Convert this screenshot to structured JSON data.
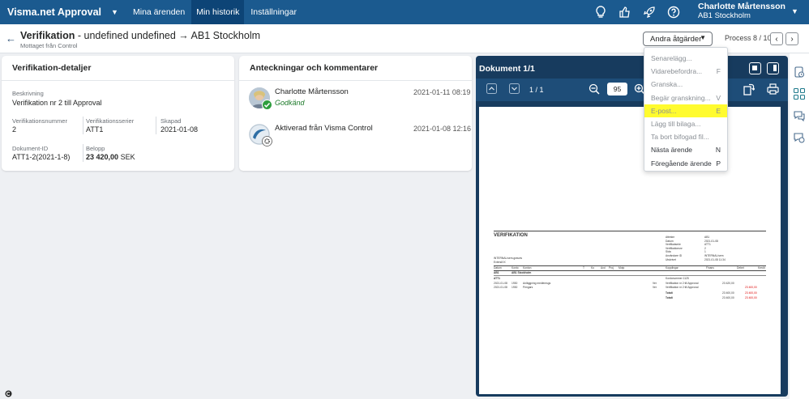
{
  "app": {
    "title": "Visma.net Approval",
    "nav": [
      {
        "label": "Mina ärenden",
        "active": false
      },
      {
        "label": "Min historik",
        "active": true
      },
      {
        "label": "Inställningar",
        "active": false
      }
    ],
    "user": {
      "name": "Charlotte Mårtensson",
      "org": "AB1 Stockholm"
    },
    "icons": [
      "lightbulb-icon",
      "thumbs-icon",
      "rocket-icon",
      "help-icon"
    ]
  },
  "header": {
    "title_bold": "Verifikation",
    "title_rest": " - undefined undefined → AB1 Stockholm",
    "subtitle": "Mottaget från Control",
    "actions_label": "Andra åtgärder",
    "process": "Process 8 / 10"
  },
  "details": {
    "heading": "Verifikation-detaljer",
    "description_label": "Beskrivning",
    "description_value": "Verifikation nr 2 till Approval",
    "number_label": "Verifikationsnummer",
    "number_value": "2",
    "series_label": "Verifikationsserier",
    "series_value": "ATT1",
    "created_label": "Skapad",
    "created_value": "2021-01-08",
    "docid_label": "Dokument-ID",
    "docid_value": "ATT1-2(2021-1-8)",
    "amount_label": "Belopp",
    "amount_value": "23 420,00",
    "amount_currency": "SEK"
  },
  "comments": {
    "heading": "Anteckningar och kommentarer",
    "items": [
      {
        "name": "Charlotte Mårtensson",
        "status": "Godkänd",
        "time": "2021-01-11 08:19"
      },
      {
        "name": "Aktiverad från Visma Control",
        "status": "",
        "time": "2021-01-08 12:16"
      }
    ]
  },
  "viewer": {
    "title": "Dokument 1/1",
    "page": "1 / 1",
    "zoom": "95"
  },
  "menu": {
    "items": [
      {
        "label": "Senarelägg...",
        "key": "",
        "enabled": false,
        "highlighted": false
      },
      {
        "label": "Vidarebefordra...",
        "key": "F",
        "enabled": false,
        "highlighted": false
      },
      {
        "label": "Granska...",
        "key": "",
        "enabled": false,
        "highlighted": false
      },
      {
        "label": "Begär granskning...",
        "key": "V",
        "enabled": false,
        "highlighted": false
      },
      {
        "label": "E-post...",
        "key": "E",
        "enabled": false,
        "highlighted": true
      },
      {
        "label": "Lägg till bilaga...",
        "key": "",
        "enabled": false,
        "highlighted": false
      },
      {
        "label": "Ta bort bifogad fil...",
        "key": "",
        "enabled": false,
        "highlighted": false
      },
      {
        "label": "Nästa ärende",
        "key": "N",
        "enabled": true,
        "highlighted": false
      },
      {
        "label": "Föregående ärende",
        "key": "P",
        "enabled": true,
        "highlighted": false
      }
    ]
  },
  "doc": {
    "heading": "VERIFIKATION",
    "meta": [
      [
        "Attestnr",
        "AB1"
      ],
      [
        "Datum",
        "2021-01-08"
      ],
      [
        "Verifikatserie",
        "ATT1"
      ],
      [
        "Verifikationsnr",
        "2"
      ],
      [
        "Sida",
        "1"
      ],
      [
        "Användare ID",
        "INTERNAL/sem"
      ],
      [
        "Utskrivet",
        "2021-01-08 11:34"
      ]
    ],
    "left_meta": [
      "INTERNAL/sem-grasvis",
      "ExtendXX"
    ],
    "columns": [
      "Datum",
      "Konto",
      "Konton",
      "T",
      "Ko",
      "Avd",
      "Proj",
      "Motp",
      "Kopplingar",
      "Finans",
      "Debet",
      "Kredit"
    ],
    "org_row": [
      "AB1",
      "AB1 Stockholm"
    ],
    "series_row": [
      "ATT1",
      "Kontonummer 1125"
    ],
    "rows": [
      {
        "date": "2021-01-08",
        "acc": "1930",
        "text": "Anläggning medlemsgs",
        "ref": "Ver",
        "info": "Verifikation nr 2 till Approval",
        "debit": "23 420,00",
        "credit": ""
      },
      {
        "date": "2021-01-08",
        "acc": "1930",
        "text": "Pengars",
        "ref": "Ver",
        "info": "Verifikation nr 2 till Approval",
        "debit": "",
        "credit": "23 400,00"
      }
    ],
    "totals": [
      {
        "label": "Totalt",
        "debit": "23 400,00",
        "credit": "23 400,00"
      },
      {
        "label": "Totalt",
        "debit": "23 400,00",
        "credit": "23 400,00"
      }
    ]
  },
  "colors": {
    "topbar": "#1b5a8f",
    "nav_active": "#0d4476",
    "viewer_bg": "#173b5e",
    "highlight": "#fffb2f",
    "approved": "#1d7a2a"
  }
}
